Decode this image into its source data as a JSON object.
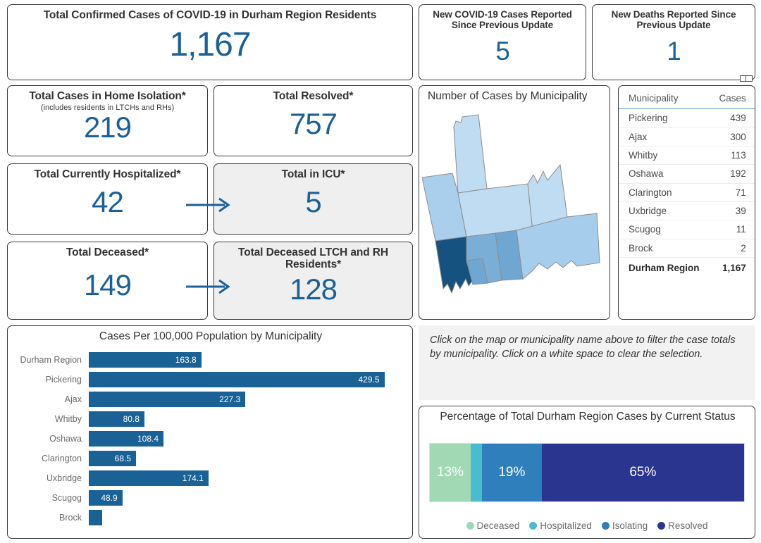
{
  "kpis": {
    "total_confirmed": {
      "title": "Total Confirmed Cases of COVID-19 in Durham Region Residents",
      "value": "1,167"
    },
    "new_cases": {
      "title": "New COVID-19 Cases Reported Since Previous Update",
      "value": "5"
    },
    "new_deaths": {
      "title": "New Deaths Reported Since Previous Update",
      "value": "1"
    },
    "home_isolation": {
      "title": "Total Cases in Home Isolation*",
      "subtitle": "(includes residents in LTCHs and RHs)",
      "value": "219"
    },
    "resolved": {
      "title": "Total Resolved*",
      "value": "757"
    },
    "hospitalized": {
      "title": "Total Currently Hospitalized*",
      "value": "42"
    },
    "icu": {
      "title": "Total in ICU*",
      "value": "5"
    },
    "deceased": {
      "title": "Total Deceased*",
      "value": "149"
    },
    "deceased_ltch": {
      "title": "Total Deceased LTCH and RH Residents*",
      "value": "128"
    }
  },
  "map_panel": {
    "title": "Number of Cases by Municipality"
  },
  "municipality_table": {
    "columns": [
      "Municipality",
      "Cases"
    ],
    "rows": [
      {
        "name": "Pickering",
        "cases": "439"
      },
      {
        "name": "Ajax",
        "cases": "300"
      },
      {
        "name": "Whitby",
        "cases": "113"
      },
      {
        "name": "Oshawa",
        "cases": "192"
      },
      {
        "name": "Clarington",
        "cases": "71"
      },
      {
        "name": "Uxbridge",
        "cases": "39"
      },
      {
        "name": "Scugog",
        "cases": "11"
      },
      {
        "name": "Brock",
        "cases": "2"
      }
    ],
    "total": {
      "name": "Durham Region",
      "cases": "1,167"
    }
  },
  "instructions": {
    "text": "Click on the map or municipality name above to filter the case totals by municipality. Click on a white space to clear the selection."
  },
  "chart_data": [
    {
      "type": "bar",
      "orientation": "horizontal",
      "title": "Cases Per 100,000 Population by Municipality",
      "xlabel": "",
      "ylabel": "",
      "grid": false,
      "xlim": [
        0,
        470
      ],
      "bar_color": "#1a6196",
      "categories": [
        "Durham Region",
        "Pickering",
        "Ajax",
        "Whitby",
        "Oshawa",
        "Clarington",
        "Uxbridge",
        "Scugog",
        "Brock"
      ],
      "values": [
        163.8,
        429.5,
        227.3,
        80.8,
        108.4,
        68.5,
        174.1,
        48.9,
        11.0
      ],
      "labels": [
        "163.8",
        "429.5",
        "227.3",
        "80.8",
        "108.4",
        "68.5",
        "174.1",
        "48.9",
        ""
      ]
    },
    {
      "type": "bar",
      "subtype": "stacked-100",
      "title": "Percentage of Total Durham Region Cases by Current Status",
      "legend_position": "bottom",
      "categories": [
        "Deceased",
        "Hospitalized",
        "Isolating",
        "Resolved"
      ],
      "values": [
        13,
        3.6,
        19,
        65
      ],
      "labels": [
        "13%",
        "",
        "19%",
        "65%"
      ],
      "colors": [
        "#a0d9b4",
        "#4bbccf",
        "#2e7fbb",
        "#2a3590"
      ]
    }
  ],
  "colors": {
    "accent_blue": "#1b6198",
    "map_fills": [
      "#bfdcf2",
      "#aacfec",
      "#a7cdec",
      "#7aaed6",
      "#6fa6d2",
      "#16527f"
    ]
  }
}
